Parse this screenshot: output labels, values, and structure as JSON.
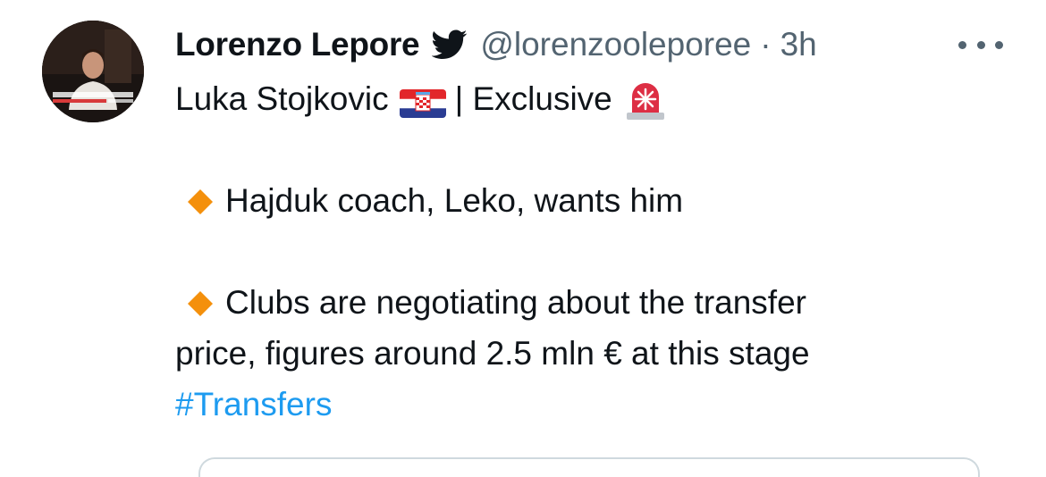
{
  "tweet": {
    "author_name": "Lorenzo Lepore",
    "handle": "@lorenzooleporee",
    "separator": "·",
    "time": "3h",
    "line1_text": "Luka Stojkovic",
    "line1_after_flag": "| Exclusive",
    "bullet1": "Hajduk coach, Leko, wants him",
    "bullet2_part1": "Clubs are negotiating about the transfer",
    "bullet2_part2": "price, figures around 2.5 mln € at this stage",
    "hashtag": "#Transfers"
  },
  "icons": {
    "verified": "twitter-bird-icon",
    "more": "more-options-icon",
    "flag": "croatia-flag-emoji",
    "siren": "police-light-emoji",
    "bullet": "orange-diamond-emoji"
  },
  "colors": {
    "text": "#0f1419",
    "secondary": "#536471",
    "link": "#1d9bf0",
    "diamond": "#f4900c"
  }
}
